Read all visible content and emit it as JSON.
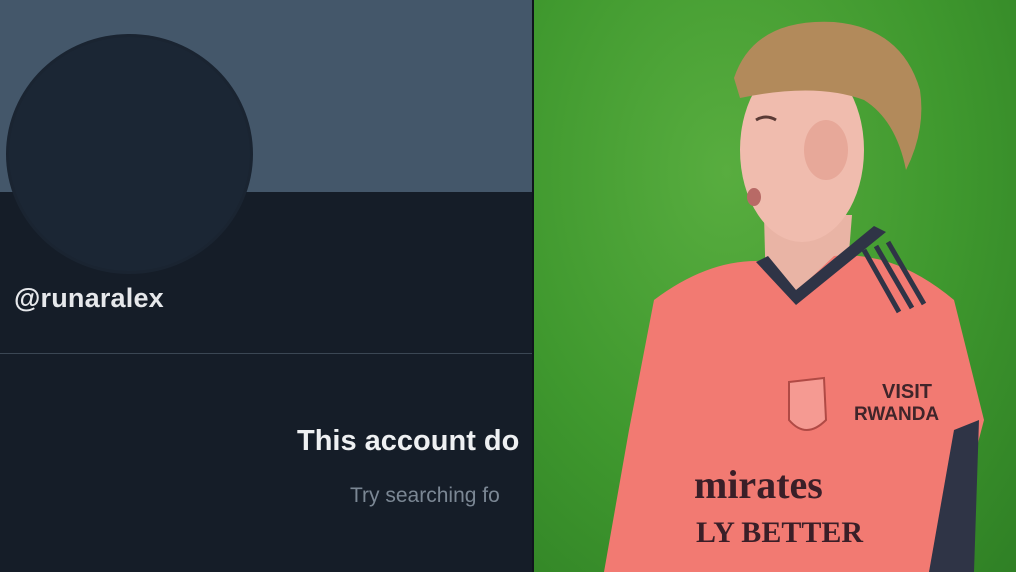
{
  "profile": {
    "handle": "@runaralex",
    "empty_state_title": "This account do",
    "empty_state_subtitle": "Try searching fo"
  },
  "photo": {
    "kit_sponsor_line1": "VISIT",
    "kit_sponsor_line2": "RWANDA",
    "shirt_sponsor_line1": "mirates",
    "shirt_sponsor_line2": "LY BETTER"
  },
  "colors": {
    "banner": "#44576a",
    "background": "#151d28",
    "avatar": "#1b2634",
    "kit": "#f27a72",
    "pitch": "#46a034"
  }
}
